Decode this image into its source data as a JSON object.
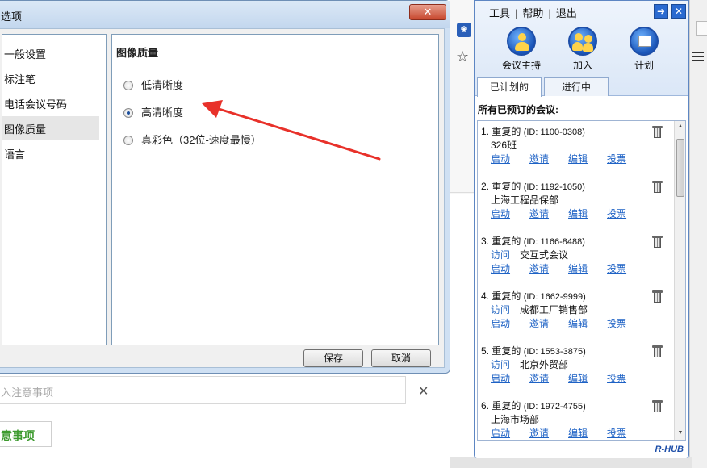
{
  "dialog": {
    "title": "选项",
    "close_glyph": "✕",
    "nav_items": [
      {
        "label": "一般设置",
        "selected": false
      },
      {
        "label": "标注笔",
        "selected": false
      },
      {
        "label": "电话会议号码",
        "selected": false
      },
      {
        "label": "图像质量",
        "selected": true
      },
      {
        "label": "语言",
        "selected": false
      }
    ],
    "section_title": "图像质量",
    "quality_options": [
      {
        "label": "低清晰度",
        "checked": false
      },
      {
        "label": "高清晰度",
        "checked": true
      },
      {
        "label": "真彩色（32位-速度最慢）",
        "checked": false
      }
    ],
    "save_label": "保存",
    "cancel_label": "取消",
    "arrow_color": "#e8312a"
  },
  "background": {
    "note_placeholder": "入注意事项",
    "note_close": "✕",
    "note_button": "意事项"
  },
  "rhub": {
    "menu": [
      "工具",
      "帮助",
      "退出"
    ],
    "actions": [
      {
        "label": "会议主持",
        "icon": "host-icon"
      },
      {
        "label": "加入",
        "icon": "join-icon"
      },
      {
        "label": "计划",
        "icon": "schedule-icon"
      }
    ],
    "tabs": [
      {
        "label": "已计划的",
        "active": true
      },
      {
        "label": "进行中",
        "active": false
      }
    ],
    "list_title": "所有已预订的会议:",
    "link_labels": [
      "启动",
      "邀请",
      "编辑",
      "投票"
    ],
    "visit_label": "访问",
    "meetings": [
      {
        "title": "1. 重复的",
        "id": "(ID: 1100-0308)",
        "name": "326班",
        "has_visit": false
      },
      {
        "title": "2. 重复的",
        "id": "(ID: 1192-1050)",
        "name": "上海工程品保部",
        "has_visit": false
      },
      {
        "title": "3. 重复的",
        "id": "(ID: 1166-8488)",
        "name": "交互式会议",
        "has_visit": true
      },
      {
        "title": "4. 重复的",
        "id": "(ID: 1662-9999)",
        "name": "成都工厂销售部",
        "has_visit": true
      },
      {
        "title": "5. 重复的",
        "id": "(ID: 1553-3875)",
        "name": "北京外贸部",
        "has_visit": true
      },
      {
        "title": "6. 重复的",
        "id": "(ID: 1972-4755)",
        "name": "上海市场部",
        "has_visit": false
      }
    ],
    "brand": "R-HUB",
    "accent": "#1e62c5"
  }
}
